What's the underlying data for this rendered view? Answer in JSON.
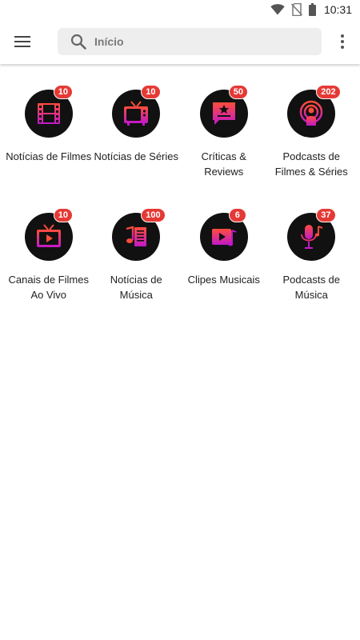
{
  "status_bar": {
    "time": "10:31",
    "icons": [
      "wifi-icon",
      "no-sim-icon",
      "battery-icon"
    ]
  },
  "app_bar": {
    "menu_icon": "hamburger-menu-icon",
    "search_icon": "search-icon",
    "search_text": "Início",
    "more_icon": "more-vert-icon"
  },
  "colors": {
    "gradient_top": "#ff4d3a",
    "gradient_bottom": "#c218c9",
    "badge": "#e53935",
    "tile_bg": "#111111"
  },
  "categories": [
    {
      "label": "Notícias de Filmes",
      "badge": "10",
      "icon": "film-strip-icon"
    },
    {
      "label": "Notícias de Séries",
      "badge": "10",
      "icon": "tv-icon"
    },
    {
      "label": "Críticas & Reviews",
      "badge": "50",
      "icon": "star-comment-icon"
    },
    {
      "label": "Podcasts de Filmes & Séries",
      "badge": "202",
      "icon": "podcast-icon"
    },
    {
      "label": "Canais de Filmes Ao Vivo",
      "badge": "10",
      "icon": "live-tv-icon"
    },
    {
      "label": "Notícias de Música",
      "badge": "100",
      "icon": "music-news-icon"
    },
    {
      "label": "Clipes Musicais",
      "badge": "6",
      "icon": "music-video-icon"
    },
    {
      "label": "Podcasts de Música",
      "badge": "37",
      "icon": "microphone-icon"
    }
  ]
}
